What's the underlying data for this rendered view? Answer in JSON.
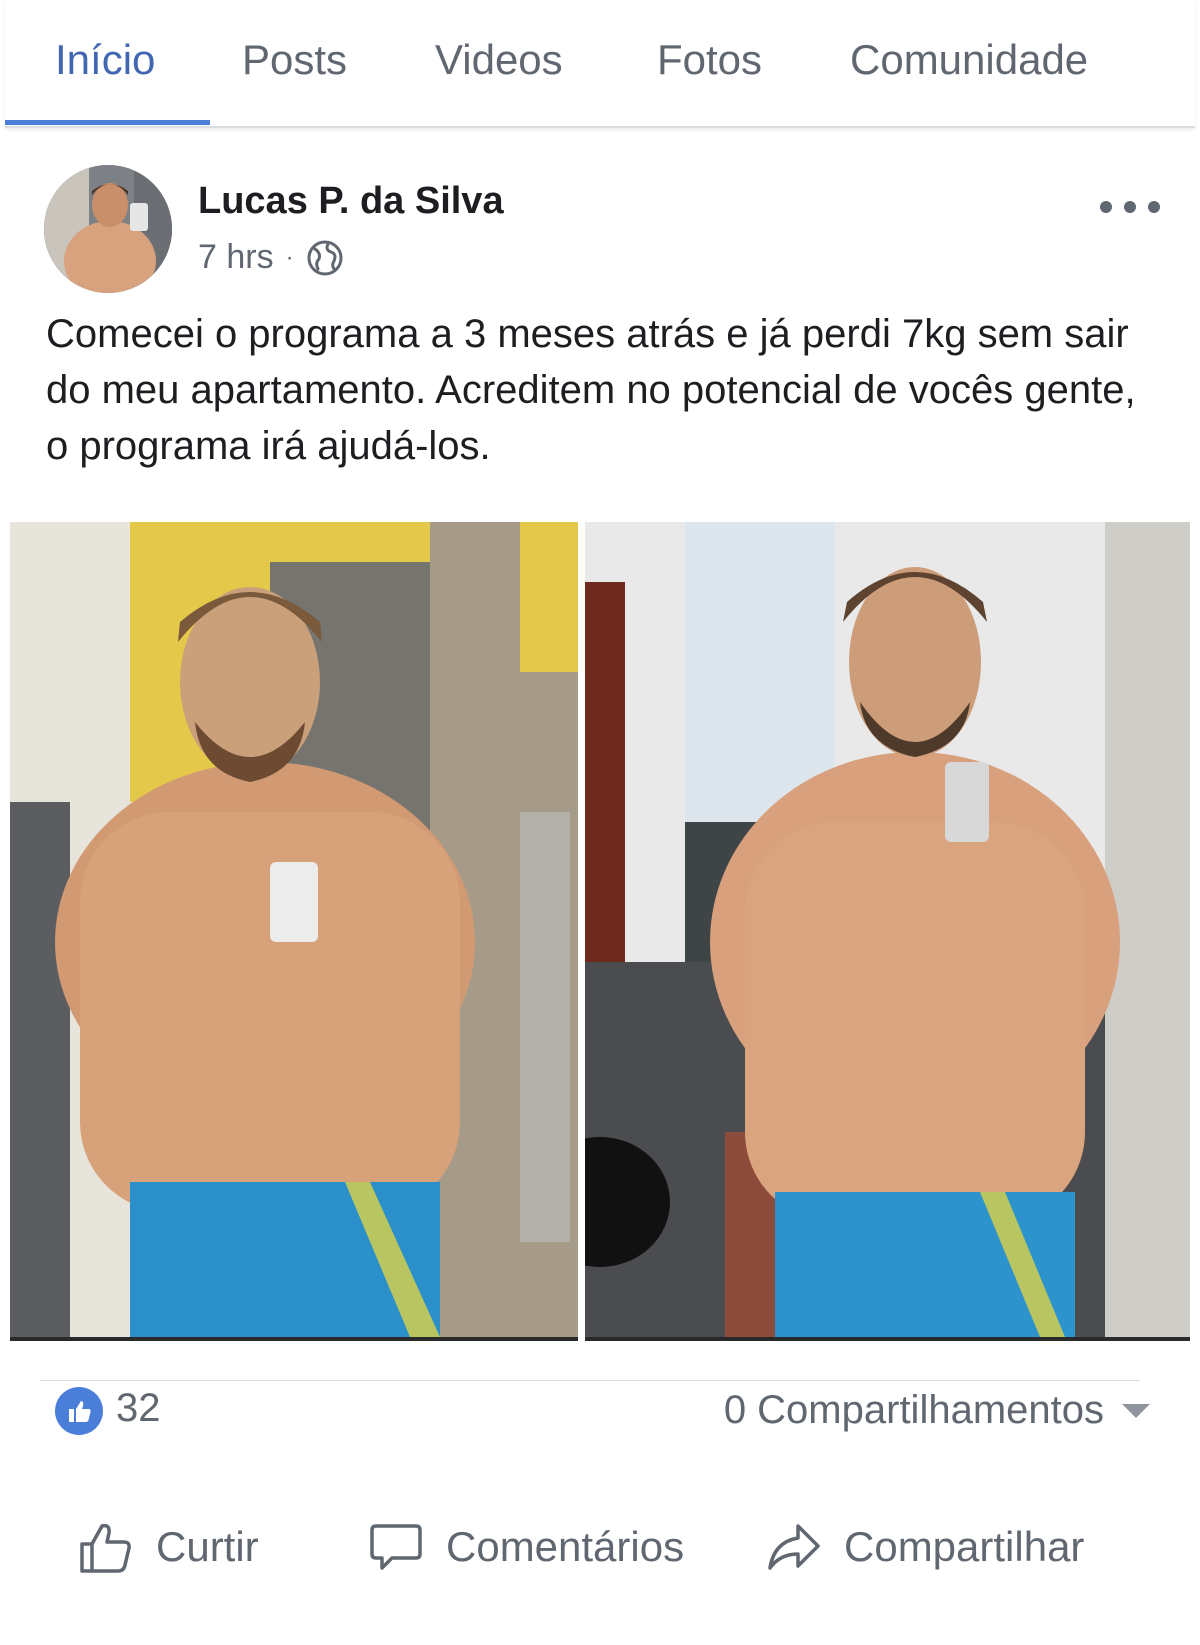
{
  "tabs": [
    {
      "label": "Início",
      "active": true
    },
    {
      "label": "Posts",
      "active": false
    },
    {
      "label": "Videos",
      "active": false
    },
    {
      "label": "Fotos",
      "active": false
    },
    {
      "label": "Comunidade",
      "active": false
    }
  ],
  "post": {
    "author": "Lucas P. da Silva",
    "time": "7 hrs",
    "separator": "·",
    "privacy_icon": "globe-icon",
    "text": "Comecei o programa a 3 meses atrás e já perdi 7kg sem sair do meu apartamento. Acreditem no potencial de vocês gente, o programa irá ajudá-los.",
    "photos": [
      "before-photo",
      "after-photo"
    ]
  },
  "stats": {
    "likes": "32",
    "shares": "0 Compartilhamentos"
  },
  "actions": {
    "like": "Curtir",
    "comment": "Comentários",
    "share": "Compartilhar"
  },
  "colors": {
    "accent": "#4267b2",
    "like_blue": "#4a7ed8",
    "muted": "#606770"
  }
}
